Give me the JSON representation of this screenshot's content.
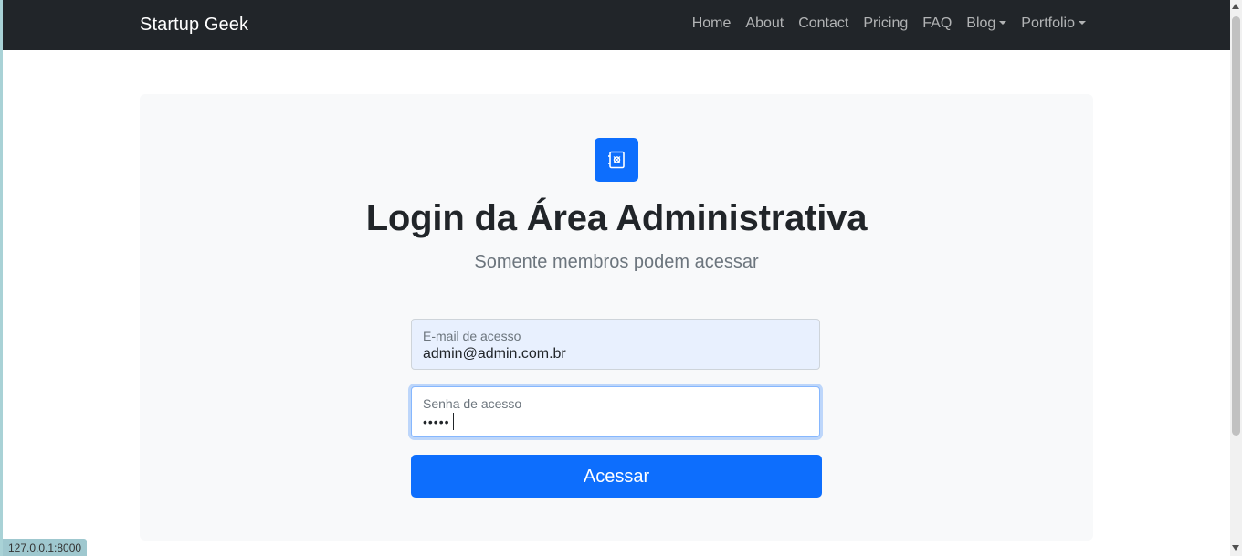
{
  "navbar": {
    "brand": "Startup Geek",
    "links": [
      "Home",
      "About",
      "Contact",
      "Pricing",
      "FAQ"
    ],
    "dropdowns": [
      "Blog",
      "Portfolio"
    ]
  },
  "login": {
    "logo_icon": "safe-icon",
    "title": "Login da Área Administrativa",
    "subtitle": "Somente membros podem acessar",
    "email_label": "E-mail de acesso",
    "email_value": "admin@admin.com.br",
    "password_label": "Senha de acesso",
    "password_mask": "•••••",
    "submit_label": "Acessar"
  },
  "status_bar": {
    "url": "127.0.0.1:8000"
  },
  "colors": {
    "navbar_bg": "#212529",
    "primary": "#0d6efd",
    "card_bg": "#f8f9fa",
    "autofill_bg": "#e8f0fe"
  }
}
